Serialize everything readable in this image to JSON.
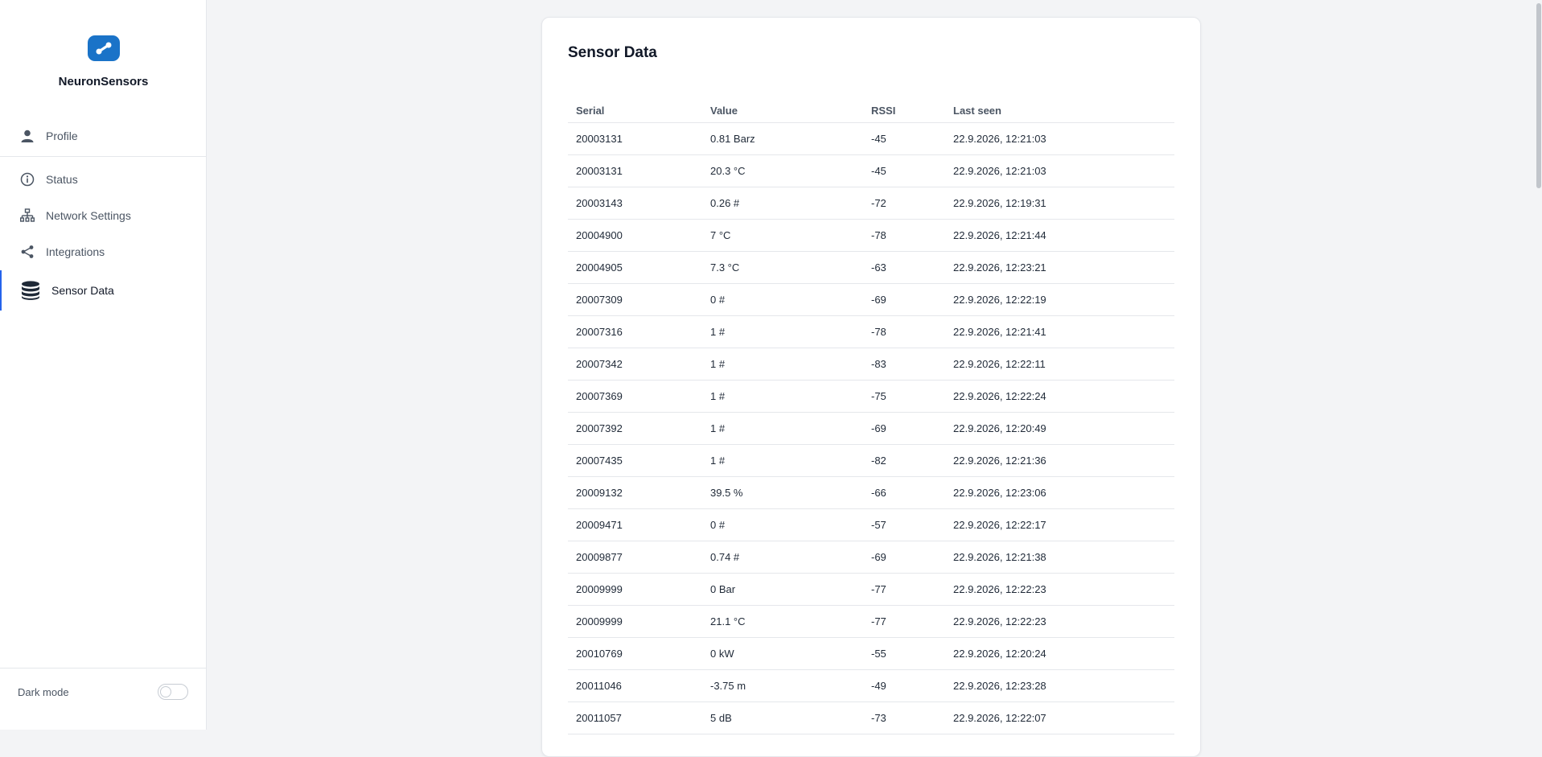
{
  "brand": {
    "name": "NeuronSensors",
    "logo_color": "#1a73c8"
  },
  "nav": {
    "items": [
      {
        "label": "Profile",
        "icon": "user-icon"
      },
      {
        "label": "Status",
        "icon": "info-icon"
      },
      {
        "label": "Network Settings",
        "icon": "network-icon"
      },
      {
        "label": "Integrations",
        "icon": "share-icon"
      },
      {
        "label": "Sensor Data",
        "icon": "database-icon",
        "active": true
      }
    ]
  },
  "footer": {
    "dark_mode_label": "Dark mode",
    "dark_mode_on": false
  },
  "page": {
    "title": "Sensor Data"
  },
  "table": {
    "headers": [
      "Serial",
      "Value",
      "RSSI",
      "Last seen"
    ],
    "rows": [
      [
        "20003131",
        "0.81 Barz",
        "-45",
        "22.9.2026, 12:21:03"
      ],
      [
        "20003131",
        "20.3 °C",
        "-45",
        "22.9.2026, 12:21:03"
      ],
      [
        "20003143",
        "0.26 #",
        "-72",
        "22.9.2026, 12:19:31"
      ],
      [
        "20004900",
        "7 °C",
        "-78",
        "22.9.2026, 12:21:44"
      ],
      [
        "20004905",
        "7.3 °C",
        "-63",
        "22.9.2026, 12:23:21"
      ],
      [
        "20007309",
        "0 #",
        "-69",
        "22.9.2026, 12:22:19"
      ],
      [
        "20007316",
        "1 #",
        "-78",
        "22.9.2026, 12:21:41"
      ],
      [
        "20007342",
        "1 #",
        "-83",
        "22.9.2026, 12:22:11"
      ],
      [
        "20007369",
        "1 #",
        "-75",
        "22.9.2026, 12:22:24"
      ],
      [
        "20007392",
        "1 #",
        "-69",
        "22.9.2026, 12:20:49"
      ],
      [
        "20007435",
        "1 #",
        "-82",
        "22.9.2026, 12:21:36"
      ],
      [
        "20009132",
        "39.5 %",
        "-66",
        "22.9.2026, 12:23:06"
      ],
      [
        "20009471",
        "0 #",
        "-57",
        "22.9.2026, 12:22:17"
      ],
      [
        "20009877",
        "0.74 #",
        "-69",
        "22.9.2026, 12:21:38"
      ],
      [
        "20009999",
        "0 Bar",
        "-77",
        "22.9.2026, 12:22:23"
      ],
      [
        "20009999",
        "21.1 °C",
        "-77",
        "22.9.2026, 12:22:23"
      ],
      [
        "20010769",
        "0 kW",
        "-55",
        "22.9.2026, 12:20:24"
      ],
      [
        "20011046",
        "-3.75 m",
        "-49",
        "22.9.2026, 12:23:28"
      ],
      [
        "20011057",
        "5 dB",
        "-73",
        "22.9.2026, 12:22:07"
      ]
    ]
  }
}
